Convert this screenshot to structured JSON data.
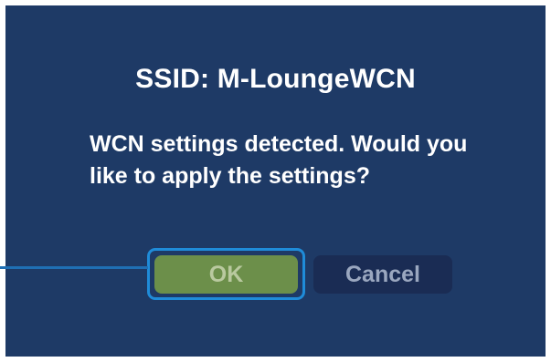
{
  "dialog": {
    "title": "SSID: M-LoungeWCN",
    "message_line1": "WCN settings detected. Would you",
    "message_line2": "like to apply the settings?"
  },
  "buttons": {
    "ok_label": "OK",
    "cancel_label": "Cancel",
    "focused": "OK"
  },
  "colors": {
    "background": "#1e3a66",
    "ok_button": "#6c8f4a",
    "cancel_button": "#1a2c54",
    "focus_highlight": "#1f8cd9",
    "callout": "#1f6fb4"
  }
}
